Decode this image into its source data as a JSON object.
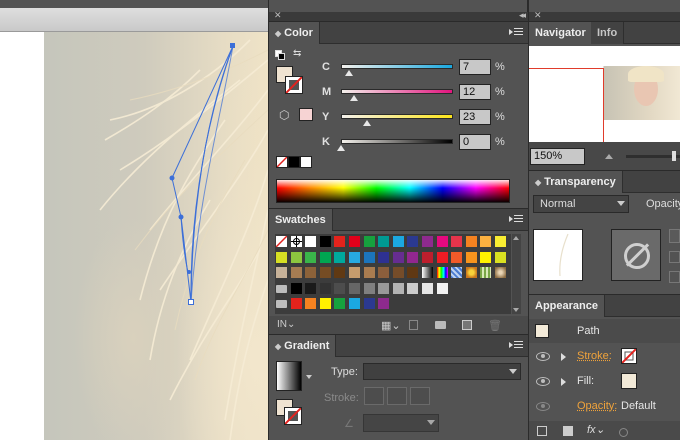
{
  "color_panel": {
    "title": "Color",
    "sliders": [
      {
        "label": "C",
        "value": "7",
        "unit": "%",
        "level": 0.07
      },
      {
        "label": "M",
        "value": "12",
        "unit": "%",
        "level": 0.12
      },
      {
        "label": "Y",
        "value": "23",
        "unit": "%",
        "level": 0.23
      },
      {
        "label": "K",
        "value": "0",
        "unit": "%",
        "level": 0.0
      }
    ],
    "fill_color": "#efe3d1",
    "out_of_web_color": "#f6d3d3"
  },
  "swatches_panel": {
    "title": "Swatches",
    "rows": [
      [
        "none",
        "registration",
        "#ffffff",
        "#000000",
        "#e4231c",
        "#e1001a",
        "#16a13e",
        "#009a93",
        "#1ba8e1",
        "#2b3990",
        "#8e2a8e",
        "#e5097f",
        "#e6344b",
        "#f58220",
        "#fbb040",
        "#f9ed32"
      ],
      [
        "#d7df23",
        "#8dc63f",
        "#3ab54a",
        "#00a651",
        "#00a99d",
        "#27aae1",
        "#1c75bc",
        "#2e3192",
        "#662d91",
        "#92278f",
        "#be1e2d",
        "#ed1c24",
        "#f15a29",
        "#f7941d",
        "#fff200",
        "#d9e021"
      ],
      [
        "#c7b299",
        "#a67c52",
        "#8c6239",
        "#754c24",
        "#603913",
        "#c69c6d",
        "#a97c50",
        "#8b5e3c",
        "#754c29",
        "#603813",
        "grad-bw",
        "grad-rainbow",
        "pattern-a",
        "pattern-b",
        "pattern-c",
        "pattern-d"
      ],
      [
        "folder",
        "#000000",
        "#1a1a1a",
        "#333333",
        "#4d4d4d",
        "#666666",
        "#808080",
        "#999999",
        "#b3b3b3",
        "#cccccc",
        "#e6e6e6",
        "#f2f2f2"
      ],
      [
        "folder",
        "#e4231c",
        "#f58220",
        "#fff200",
        "#16a13e",
        "#1ba8e1",
        "#2b3990",
        "#8e2a8e"
      ]
    ]
  },
  "gradient_panel": {
    "title": "Gradient",
    "type_label": "Type:",
    "stroke_label": "Stroke:"
  },
  "navigator_panel": {
    "tabs": [
      "Navigator",
      "Info"
    ],
    "zoom": "150%"
  },
  "transparency_panel": {
    "title": "Transparency",
    "blend_mode": "Normal",
    "opacity_label": "Opacity"
  },
  "appearance_panel": {
    "title": "Appearance",
    "object_label": "Path",
    "rows": [
      {
        "label": "Stroke:",
        "swatch": "none"
      },
      {
        "label": "Fill:",
        "swatch": "#f3ead8"
      }
    ],
    "opacity_label": "Opacity:",
    "opacity_value": "Default",
    "fx_label": "fx"
  },
  "colors": {
    "panel_bg": "#535353",
    "path_blue": "#3c6fd8",
    "stroke_orange": "#f0a33b"
  }
}
